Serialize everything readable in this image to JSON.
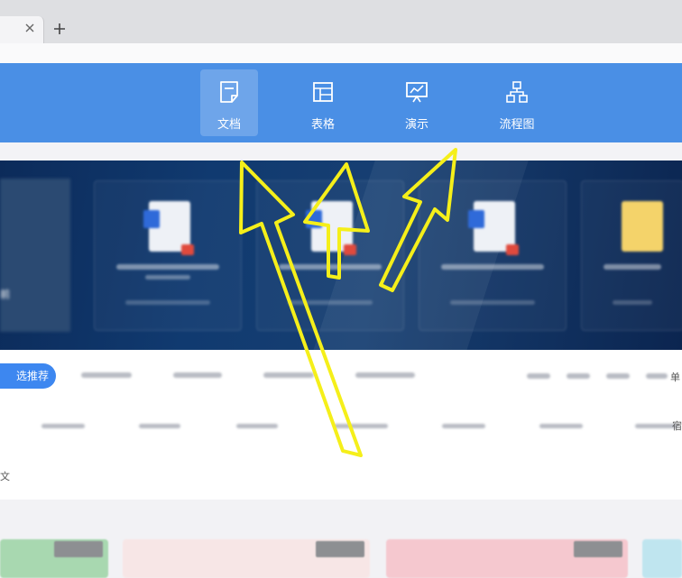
{
  "browser": {
    "new_tab_symbol": "+"
  },
  "toolbar": {
    "items": [
      {
        "label": "文档",
        "icon": "document-icon",
        "active": true
      },
      {
        "label": "表格",
        "icon": "table-icon",
        "active": false
      },
      {
        "label": "演示",
        "icon": "presentation-icon",
        "active": false
      },
      {
        "label": "流程图",
        "icon": "flowchart-icon",
        "active": false
      }
    ]
  },
  "categories": {
    "active_label": "选推荐"
  },
  "edge_text": {
    "left_banner": "前",
    "left_sub": "文",
    "right_top": "单",
    "right_bottom": "宿"
  },
  "annotation": {
    "arrow_color": "#f5ef1a"
  },
  "colors": {
    "toolbar": "#4a8fe5",
    "accent": "#3d87f0"
  }
}
